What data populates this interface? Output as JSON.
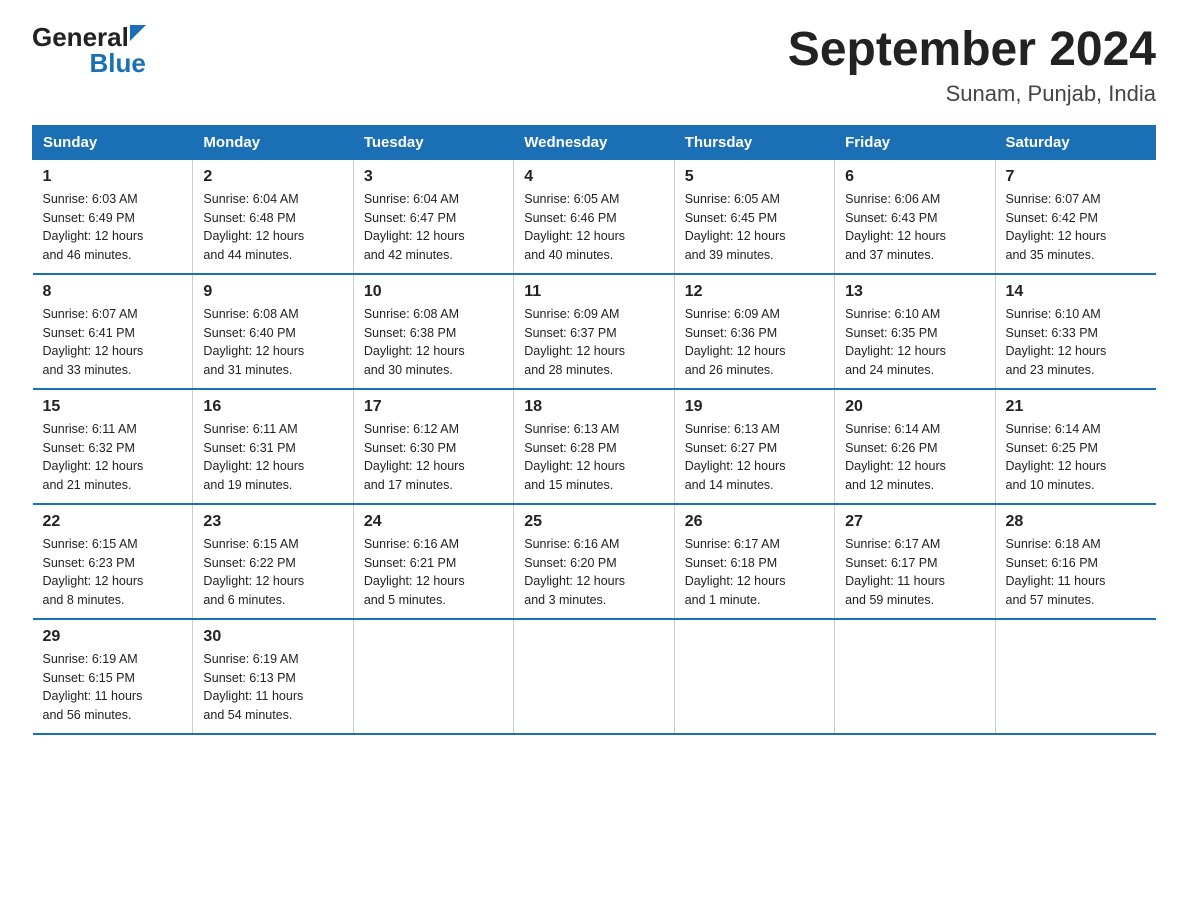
{
  "header": {
    "logo_general": "General",
    "logo_blue": "Blue",
    "title": "September 2024",
    "subtitle": "Sunam, Punjab, India"
  },
  "days_of_week": [
    "Sunday",
    "Monday",
    "Tuesday",
    "Wednesday",
    "Thursday",
    "Friday",
    "Saturday"
  ],
  "weeks": [
    [
      {
        "day": "1",
        "sunrise": "6:03 AM",
        "sunset": "6:49 PM",
        "daylight": "12 hours and 46 minutes."
      },
      {
        "day": "2",
        "sunrise": "6:04 AM",
        "sunset": "6:48 PM",
        "daylight": "12 hours and 44 minutes."
      },
      {
        "day": "3",
        "sunrise": "6:04 AM",
        "sunset": "6:47 PM",
        "daylight": "12 hours and 42 minutes."
      },
      {
        "day": "4",
        "sunrise": "6:05 AM",
        "sunset": "6:46 PM",
        "daylight": "12 hours and 40 minutes."
      },
      {
        "day": "5",
        "sunrise": "6:05 AM",
        "sunset": "6:45 PM",
        "daylight": "12 hours and 39 minutes."
      },
      {
        "day": "6",
        "sunrise": "6:06 AM",
        "sunset": "6:43 PM",
        "daylight": "12 hours and 37 minutes."
      },
      {
        "day": "7",
        "sunrise": "6:07 AM",
        "sunset": "6:42 PM",
        "daylight": "12 hours and 35 minutes."
      }
    ],
    [
      {
        "day": "8",
        "sunrise": "6:07 AM",
        "sunset": "6:41 PM",
        "daylight": "12 hours and 33 minutes."
      },
      {
        "day": "9",
        "sunrise": "6:08 AM",
        "sunset": "6:40 PM",
        "daylight": "12 hours and 31 minutes."
      },
      {
        "day": "10",
        "sunrise": "6:08 AM",
        "sunset": "6:38 PM",
        "daylight": "12 hours and 30 minutes."
      },
      {
        "day": "11",
        "sunrise": "6:09 AM",
        "sunset": "6:37 PM",
        "daylight": "12 hours and 28 minutes."
      },
      {
        "day": "12",
        "sunrise": "6:09 AM",
        "sunset": "6:36 PM",
        "daylight": "12 hours and 26 minutes."
      },
      {
        "day": "13",
        "sunrise": "6:10 AM",
        "sunset": "6:35 PM",
        "daylight": "12 hours and 24 minutes."
      },
      {
        "day": "14",
        "sunrise": "6:10 AM",
        "sunset": "6:33 PM",
        "daylight": "12 hours and 23 minutes."
      }
    ],
    [
      {
        "day": "15",
        "sunrise": "6:11 AM",
        "sunset": "6:32 PM",
        "daylight": "12 hours and 21 minutes."
      },
      {
        "day": "16",
        "sunrise": "6:11 AM",
        "sunset": "6:31 PM",
        "daylight": "12 hours and 19 minutes."
      },
      {
        "day": "17",
        "sunrise": "6:12 AM",
        "sunset": "6:30 PM",
        "daylight": "12 hours and 17 minutes."
      },
      {
        "day": "18",
        "sunrise": "6:13 AM",
        "sunset": "6:28 PM",
        "daylight": "12 hours and 15 minutes."
      },
      {
        "day": "19",
        "sunrise": "6:13 AM",
        "sunset": "6:27 PM",
        "daylight": "12 hours and 14 minutes."
      },
      {
        "day": "20",
        "sunrise": "6:14 AM",
        "sunset": "6:26 PM",
        "daylight": "12 hours and 12 minutes."
      },
      {
        "day": "21",
        "sunrise": "6:14 AM",
        "sunset": "6:25 PM",
        "daylight": "12 hours and 10 minutes."
      }
    ],
    [
      {
        "day": "22",
        "sunrise": "6:15 AM",
        "sunset": "6:23 PM",
        "daylight": "12 hours and 8 minutes."
      },
      {
        "day": "23",
        "sunrise": "6:15 AM",
        "sunset": "6:22 PM",
        "daylight": "12 hours and 6 minutes."
      },
      {
        "day": "24",
        "sunrise": "6:16 AM",
        "sunset": "6:21 PM",
        "daylight": "12 hours and 5 minutes."
      },
      {
        "day": "25",
        "sunrise": "6:16 AM",
        "sunset": "6:20 PM",
        "daylight": "12 hours and 3 minutes."
      },
      {
        "day": "26",
        "sunrise": "6:17 AM",
        "sunset": "6:18 PM",
        "daylight": "12 hours and 1 minute."
      },
      {
        "day": "27",
        "sunrise": "6:17 AM",
        "sunset": "6:17 PM",
        "daylight": "11 hours and 59 minutes."
      },
      {
        "day": "28",
        "sunrise": "6:18 AM",
        "sunset": "6:16 PM",
        "daylight": "11 hours and 57 minutes."
      }
    ],
    [
      {
        "day": "29",
        "sunrise": "6:19 AM",
        "sunset": "6:15 PM",
        "daylight": "11 hours and 56 minutes."
      },
      {
        "day": "30",
        "sunrise": "6:19 AM",
        "sunset": "6:13 PM",
        "daylight": "11 hours and 54 minutes."
      },
      null,
      null,
      null,
      null,
      null
    ]
  ],
  "labels": {
    "sunrise": "Sunrise:",
    "sunset": "Sunset:",
    "daylight": "Daylight:"
  }
}
